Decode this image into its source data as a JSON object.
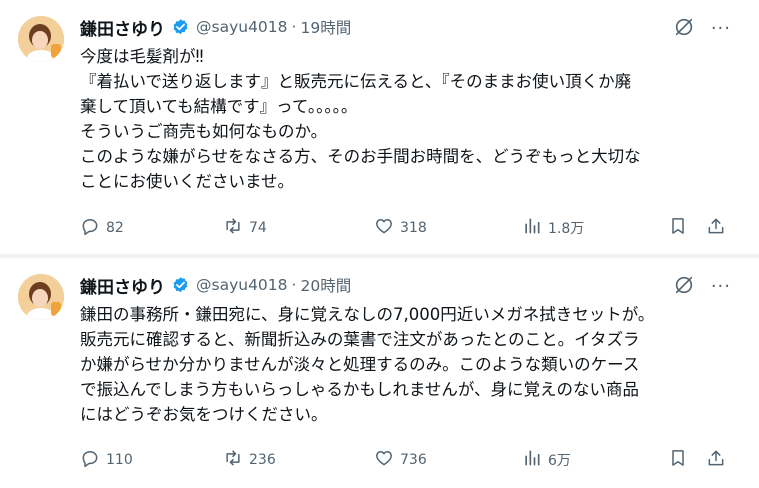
{
  "tweets": [
    {
      "author": {
        "name": "鎌田さゆり",
        "handle": "@sayu4018"
      },
      "separator": "·",
      "time": "19時間",
      "body_lines": [
        "今度は毛髪剤が‼",
        "『着払いで送り返します』と販売元に伝えると、『そのままお使い頂くか廃",
        "棄して頂いても結構です』って。。。。。",
        "そういうご商売も如何なものか。",
        "このような嫌がらせをなさる方、そのお手間お時間を、どうぞもっと大切な",
        "ことにお使いくださいませ。"
      ],
      "stats": {
        "replies": "82",
        "reposts": "74",
        "likes": "318",
        "views": "1.8万"
      }
    },
    {
      "author": {
        "name": "鎌田さゆり",
        "handle": "@sayu4018"
      },
      "separator": "·",
      "time": "20時間",
      "body_lines": [
        "鎌田の事務所・鎌田宛に、身に覚えなしの7,000円近いメガネ拭きセットが。",
        "販売元に確認すると、新聞折込みの葉書で注文があったとのこと。イタズラ",
        "か嫌がらせか分かりませんが淡々と処理するのみ。このような類いのケース",
        "で振込んでしまう方もいらっしゃるかもしれませんが、身に覚えのない商品",
        "にはどうぞお気をつけください。"
      ],
      "stats": {
        "replies": "110",
        "reposts": "236",
        "likes": "736",
        "views": "6万"
      }
    }
  ],
  "icons": {
    "verified": "verified-badge-icon",
    "grok": "grok-slash-icon",
    "more": "more-icon",
    "reply": "reply-icon",
    "repost": "repost-icon",
    "like": "like-icon",
    "views": "views-icon",
    "bookmark": "bookmark-icon",
    "share": "share-icon"
  },
  "more_label": "···",
  "colors": {
    "verified": "#1d9bf0",
    "muted": "#536471",
    "text": "#0f1419",
    "divider": "#eff3f4"
  }
}
